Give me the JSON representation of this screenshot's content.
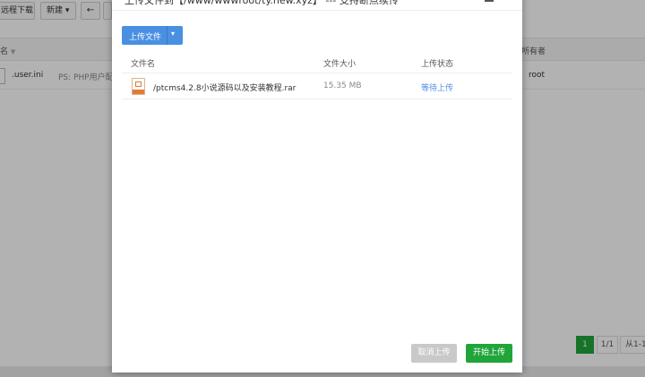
{
  "background": {
    "toolbar": {
      "remote_download": "远程下载",
      "new": "新建",
      "new_caret": "▾",
      "back_icon": "←"
    },
    "table": {
      "name_header": "名",
      "name_sort_icon": "▼",
      "owner_header": "所有者",
      "rows": [
        {
          "name": ".user.ini",
          "ps": "PS: PHP用户配",
          "owner": "root"
        }
      ]
    },
    "pager": {
      "current": "1",
      "total": "1/1",
      "range": "从1-1"
    }
  },
  "modal": {
    "title": "上传文件到【/www/wwwroot/ty.new.xyz】 --- 支持断点续传",
    "upload_button": "上传文件",
    "upload_caret": "▾",
    "close_glyph": "✕",
    "columns": {
      "name": "文件名",
      "size": "文件大小",
      "status": "上传状态"
    },
    "files": [
      {
        "name": "/ptcms4.2.8小说源码以及安装教程.rar",
        "size": "15.35 MB",
        "status": "等待上传"
      }
    ],
    "cancel_button": "取消上传",
    "start_button": "开始上传"
  },
  "colors": {
    "primary_blue": "#4a90e2",
    "success_green": "#20a53a",
    "disabled_gray": "#c9c9c9",
    "rar_orange": "#e07b39"
  }
}
